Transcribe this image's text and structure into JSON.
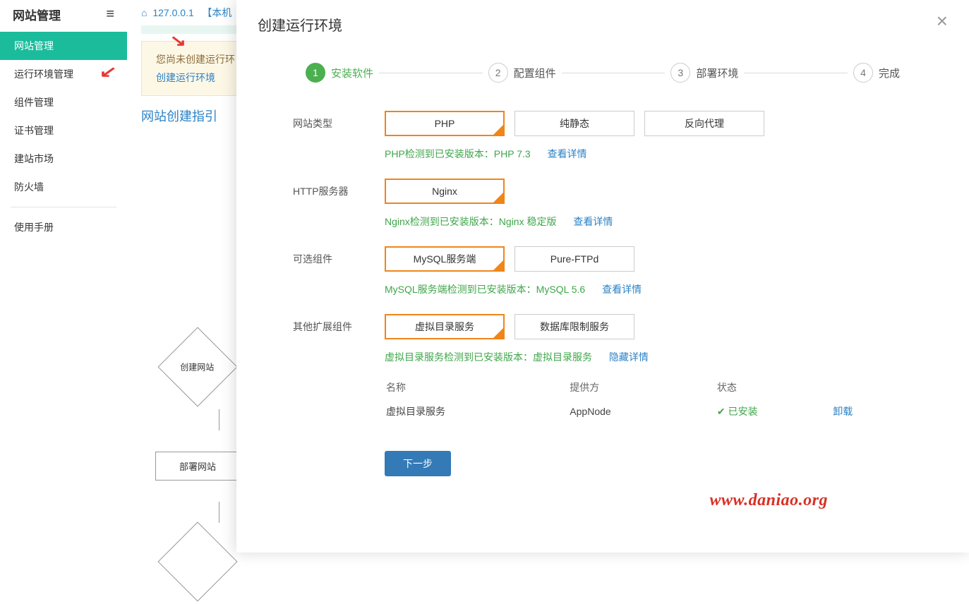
{
  "sidebar": {
    "title": "网站管理",
    "items": [
      {
        "label": "网站管理",
        "active": true
      },
      {
        "label": "运行环境管理",
        "active": false
      },
      {
        "label": "组件管理",
        "active": false
      },
      {
        "label": "证书管理",
        "active": false
      },
      {
        "label": "建站市场",
        "active": false
      },
      {
        "label": "防火墙",
        "active": false
      }
    ],
    "manual": "使用手册"
  },
  "breadcrumb": {
    "host": "127.0.0.1",
    "tag": "【本机"
  },
  "hint": {
    "text": "您尚未创建运行环",
    "link": "创建运行环境"
  },
  "guide": {
    "title": "网站创建指引",
    "node1": "创建网站",
    "node2": "部署网站"
  },
  "modal": {
    "title": "创建运行环境",
    "steps": [
      {
        "num": "1",
        "label": "安装软件",
        "active": true
      },
      {
        "num": "2",
        "label": "配置组件",
        "active": false
      },
      {
        "num": "3",
        "label": "部署环境",
        "active": false
      },
      {
        "num": "4",
        "label": "完成",
        "active": false
      }
    ],
    "rows": {
      "site_type": {
        "label": "网站类型",
        "options": [
          "PHP",
          "纯静态",
          "反向代理"
        ],
        "selected": 0,
        "detect": "PHP检测到已安装版本：PHP 7.3",
        "detail_link": "查看详情"
      },
      "http_server": {
        "label": "HTTP服务器",
        "options": [
          "Nginx"
        ],
        "selected": 0,
        "detect": "Nginx检测到已安装版本：Nginx 稳定版",
        "detail_link": "查看详情"
      },
      "optional": {
        "label": "可选组件",
        "options": [
          "MySQL服务端",
          "Pure-FTPd"
        ],
        "selected": 0,
        "detect": "MySQL服务端检测到已安装版本：MySQL 5.6",
        "detail_link": "查看详情"
      },
      "extension": {
        "label": "其他扩展组件",
        "options": [
          "虚拟目录服务",
          "数据库限制服务"
        ],
        "selected": 0,
        "detect": "虚拟目录服务检测到已安装版本：虚拟目录服务",
        "detail_link": "隐藏详情"
      }
    },
    "details_table": {
      "headers": [
        "名称",
        "提供方",
        "状态",
        ""
      ],
      "row": {
        "name": "虚拟目录服务",
        "provider": "AppNode",
        "status": "已安装",
        "action": "卸载"
      }
    },
    "next": "下一步"
  },
  "watermark": "www.daniao.org"
}
